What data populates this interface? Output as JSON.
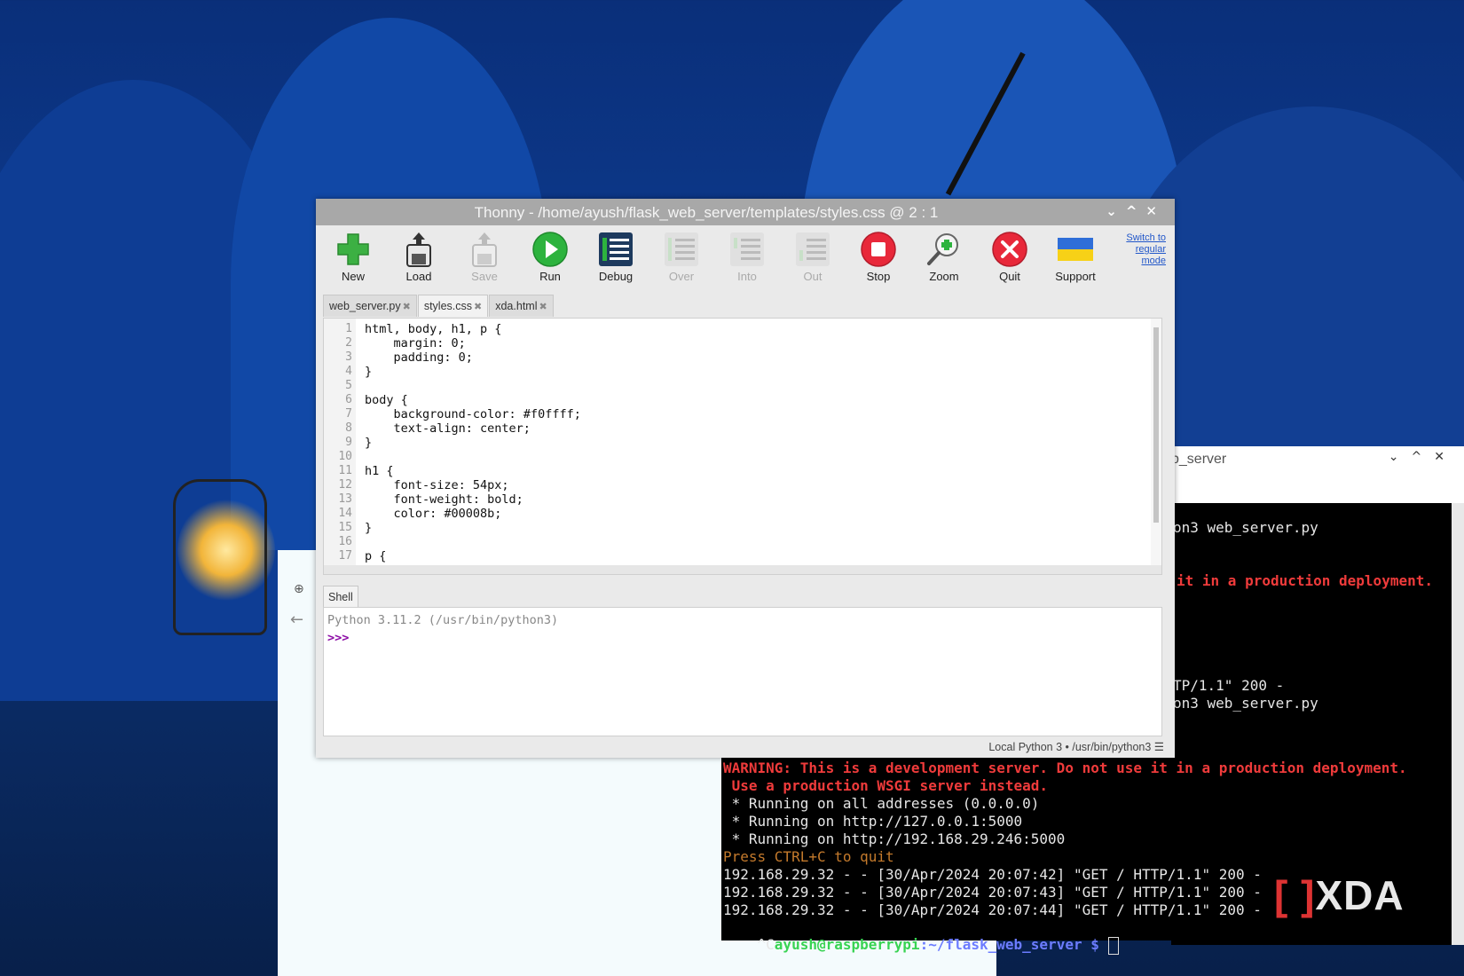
{
  "thonny": {
    "title": "Thonny  -  /home/ayush/flask_web_server/templates/styles.css  @  2 : 1",
    "window_controls": [
      "⌄",
      "^",
      "✕"
    ],
    "toolbar": {
      "new": "New",
      "load": "Load",
      "save": "Save",
      "run": "Run",
      "debug": "Debug",
      "over": "Over",
      "into": "Into",
      "out": "Out",
      "stop": "Stop",
      "zoom": "Zoom",
      "quit": "Quit",
      "support": "Support"
    },
    "switch_mode": "Switch to regular mode",
    "tabs": [
      "web_server.py",
      "styles.css",
      "xda.html"
    ],
    "tab_close": "✖",
    "editor": {
      "line_numbers": [
        "1",
        "2",
        "3",
        "4",
        "5",
        "6",
        "7",
        "8",
        "9",
        "10",
        "11",
        "12",
        "13",
        "14",
        "15",
        "16",
        "17"
      ],
      "lines": [
        "html, body, h1, p {",
        "    margin: 0;",
        "    padding: 0;",
        "}",
        "",
        "body {",
        "    background-color: #f0ffff;",
        "    text-align: center;",
        "}",
        "",
        "h1 {",
        "    font-size: 54px;",
        "    font-weight: bold;",
        "    color: #00008b;",
        "}",
        "",
        "p {"
      ]
    },
    "shell": {
      "tab_label": "Shell",
      "version_line": "Python 3.11.2 (/usr/bin/python3)",
      "prompt": ">>>"
    },
    "status": "Local Python 3  •  /usr/bin/python3  ☰"
  },
  "terminal": {
    "title": "b_server",
    "controls": [
      "⌄",
      "^",
      "✕"
    ],
    "upper_lines": [
      {
        "text": "on3 web_server.py",
        "style": "white"
      },
      {
        "text": "it in a production deployment.",
        "style": "red"
      },
      {
        "text": "TP/1.1\" 200 -",
        "style": "white"
      },
      {
        "text": "on3 web_server.py",
        "style": "white"
      }
    ],
    "lower_lines": [
      {
        "text": "WARNING: This is a development server. Do not use it in a production deployment.",
        "style": "red"
      },
      {
        "text": " Use a production WSGI server instead.",
        "style": "red"
      },
      {
        "text": " * Running on all addresses (0.0.0.0)",
        "style": "white"
      },
      {
        "text": " * Running on http://127.0.0.1:5000",
        "style": "white"
      },
      {
        "text": " * Running on http://192.168.29.246:5000",
        "style": "white"
      },
      {
        "text": "Press CTRL+C to quit",
        "style": "orange"
      },
      {
        "text": "192.168.29.32 - - [30/Apr/2024 20:07:42] \"GET / HTTP/1.1\" 200 -",
        "style": "white"
      },
      {
        "text": "192.168.29.32 - - [30/Apr/2024 20:07:43] \"GET / HTTP/1.1\" 200 -",
        "style": "white"
      },
      {
        "text": "192.168.29.32 - - [30/Apr/2024 20:07:44] \"GET / HTTP/1.1\" 200 -",
        "style": "white"
      }
    ],
    "prompt": {
      "prefix": "^C",
      "user_host": "ayush@raspberrypi",
      "path": ":~/flask_web_server $"
    }
  },
  "watermark": "XDA",
  "colors": {
    "desktop": "#0d3a8c",
    "thonny_titlebar": "#a8a8a8",
    "run_green": "#2db33e",
    "stop_red": "#e8283a",
    "terminal_red": "#ef3b3b",
    "terminal_green": "#39d353",
    "terminal_blue": "#6c7cff"
  }
}
